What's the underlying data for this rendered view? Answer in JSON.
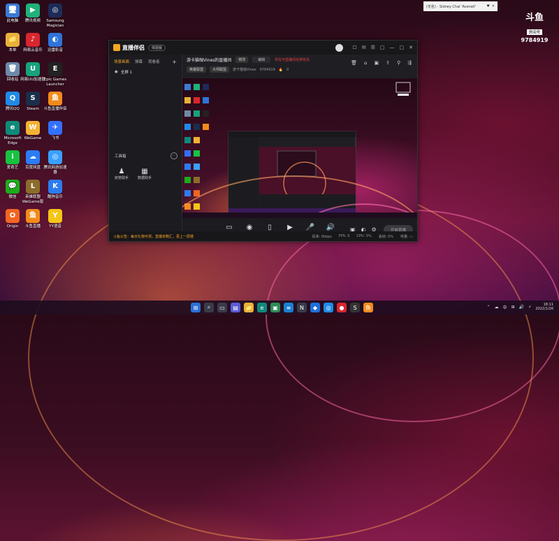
{
  "desktop": {
    "icons": [
      {
        "label": "此电脑",
        "glyph": "🖥",
        "bg": "#3a7bd5"
      },
      {
        "label": "腾讯视频",
        "glyph": "▶",
        "bg": "#1fb27a"
      },
      {
        "label": "Samsung Magician",
        "glyph": "◎",
        "bg": "#1d2b57"
      },
      {
        "label": "本单",
        "glyph": "📁",
        "bg": "#e8b13a"
      },
      {
        "label": "网易云音乐",
        "glyph": "♪",
        "bg": "#d8262e"
      },
      {
        "label": "迅雷影音",
        "glyph": "◐",
        "bg": "#2e74d9"
      },
      {
        "label": "回收站",
        "glyph": "🗑",
        "bg": "#6c8aa8"
      },
      {
        "label": "网易UU加速器",
        "glyph": "U",
        "bg": "#16a37c"
      },
      {
        "label": "Epic Games Launcher",
        "glyph": "E",
        "bg": "#222"
      },
      {
        "label": "腾讯QQ",
        "glyph": "Q",
        "bg": "#1f8ae6"
      },
      {
        "label": "Steam",
        "glyph": "S",
        "bg": "#1a2f4a"
      },
      {
        "label": "斗鱼直播伴侣",
        "glyph": "鱼",
        "bg": "#f28a1b"
      },
      {
        "label": "Microsoft Edge",
        "glyph": "e",
        "bg": "#0e8a7a"
      },
      {
        "label": "WeGame",
        "glyph": "W",
        "bg": "#f2b233"
      },
      {
        "label": "飞书",
        "glyph": "✈",
        "bg": "#3370ff"
      },
      {
        "label": "爱奇艺",
        "glyph": "i",
        "bg": "#17c240"
      },
      {
        "label": "百度网盘",
        "glyph": "☁",
        "bg": "#2b7cf6"
      },
      {
        "label": "腾讯网游加速器",
        "glyph": "◎",
        "bg": "#3aa0ff"
      },
      {
        "label": "微信",
        "glyph": "💬",
        "bg": "#1aad19"
      },
      {
        "label": "英雄联盟WeGame版",
        "glyph": "L",
        "bg": "#8a6d2b"
      },
      {
        "label": "酷狗音乐",
        "glyph": "K",
        "bg": "#2d7cf0"
      },
      {
        "label": "Origin",
        "glyph": "O",
        "bg": "#f26522"
      },
      {
        "label": "斗鱼直播",
        "glyph": "鱼",
        "bg": "#f28a1b"
      },
      {
        "label": "YY语音",
        "glyph": "Y",
        "bg": "#f5c518"
      }
    ]
  },
  "notification": {
    "text": "(无名) - Sidney Chai 'Avenell'",
    "icons": [
      "◌",
      "♥",
      "▣",
      "✕"
    ]
  },
  "watermark": {
    "brand": "斗鱼",
    "sub": "房间号",
    "room": "9784919"
  },
  "app": {
    "name": "直播伴侣",
    "badge": "体验版",
    "title_icons": [
      "☐",
      "✉",
      "☰",
      "▢",
      "—",
      "▢",
      "✕"
    ],
    "sidebar": {
      "tabs": [
        "场景画面",
        "弹幕",
        "观看者"
      ],
      "plus": "+",
      "scene": "全屏 1",
      "tools_title": "工具箱",
      "tools_more": "···",
      "tools": [
        {
          "icon": "♟",
          "label": "房管助手"
        },
        {
          "icon": "▦",
          "label": "数据助手"
        }
      ]
    },
    "stream": {
      "title": "游卡猫咖Vines的直播间",
      "title_chip": "修改",
      "edit_box": "编辑",
      "warning": "你在与直播间名称有关",
      "category": "英雄联盟",
      "category2": "大师联盟",
      "tag": "游卡猫咖Vines",
      "room": "9784919",
      "fire": "🔥",
      "fire_count": "0",
      "icons": [
        "🗑",
        "⌂",
        "▣",
        "⇪",
        "⚲",
        "⇶"
      ]
    },
    "bottom_tools": [
      {
        "icon": "▭",
        "label": "直播屏幕"
      },
      {
        "icon": "◉",
        "label": "摄像头"
      },
      {
        "icon": "▯",
        "label": "手机投屏"
      },
      {
        "icon": "▶",
        "label": "录视频"
      },
      {
        "icon": "🎤",
        "label": "麦克风"
      },
      {
        "icon": "🔊",
        "label": "扬声器"
      }
    ],
    "right_tools": [
      "▣",
      "◐",
      "⚙"
    ],
    "start_live": "开始直播",
    "statusbar": {
      "notice": "斗鱼公告：每日礼物可领，直播攻略汇，更上一层楼",
      "stats": [
        "码率: 0kbps",
        "FPS: 0",
        "CPU: 5%",
        "丢帧: 0%",
        "电量: ▭"
      ]
    }
  },
  "taskbar": {
    "icons": [
      {
        "glyph": "⊞",
        "bg": "#2b6fd6"
      },
      {
        "glyph": "⌕",
        "bg": "#3a3a4a"
      },
      {
        "glyph": "▭",
        "bg": "#3a3a4a"
      },
      {
        "glyph": "▤",
        "bg": "#5b5bd6"
      },
      {
        "glyph": "📁",
        "bg": "#e8b13a"
      },
      {
        "glyph": "e",
        "bg": "#0e8a7a"
      },
      {
        "glyph": "▣",
        "bg": "#2e8b57"
      },
      {
        "glyph": "≡",
        "bg": "#1a7fd1"
      },
      {
        "glyph": "N",
        "bg": "#3a3a4a"
      },
      {
        "glyph": "◆",
        "bg": "#1f6fd9"
      },
      {
        "glyph": "◎",
        "bg": "#1f8ae6"
      },
      {
        "glyph": "●",
        "bg": "#d8262e"
      },
      {
        "glyph": "S",
        "bg": "#333"
      },
      {
        "glyph": "鱼",
        "bg": "#f28a1b"
      }
    ],
    "tray": [
      "⌃",
      "☁",
      "中",
      "⊞",
      "🔊",
      "⚡"
    ],
    "time": "18:11",
    "date": "2022/1/26"
  }
}
